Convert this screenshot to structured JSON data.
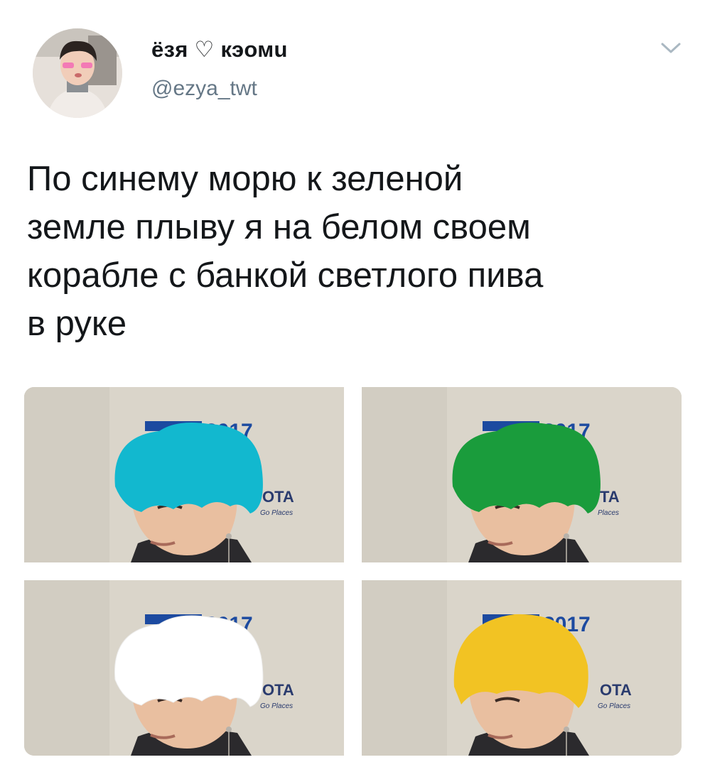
{
  "tweet": {
    "author": {
      "display_name": "ёзя ♡ кэомu",
      "handle": "@ezya_twt"
    },
    "text": "По синему морю к зеленой\nземле плыву я на белом своем\nкорабле с банкой светлого пива\nв руке",
    "menu_icon": "chevron-down-icon",
    "media": [
      {
        "hair_color": "#12b8cf",
        "hair_style": "painted",
        "backdrop_text": "2017",
        "sponsor_text": "OTA",
        "sponsor_sub": "Go Places"
      },
      {
        "hair_color": "#1a9c3c",
        "hair_style": "painted",
        "backdrop_text": "2017",
        "sponsor_text": "TA",
        "sponsor_sub": "Places"
      },
      {
        "hair_color": "#ffffff",
        "hair_style": "painted",
        "backdrop_text": "2017",
        "sponsor_text": "OTA",
        "sponsor_sub": "Go Places"
      },
      {
        "hair_color": "#f2c323",
        "hair_style": "natural",
        "backdrop_text": "2017",
        "sponsor_text": "OTA",
        "sponsor_sub": "Go Places"
      }
    ]
  }
}
